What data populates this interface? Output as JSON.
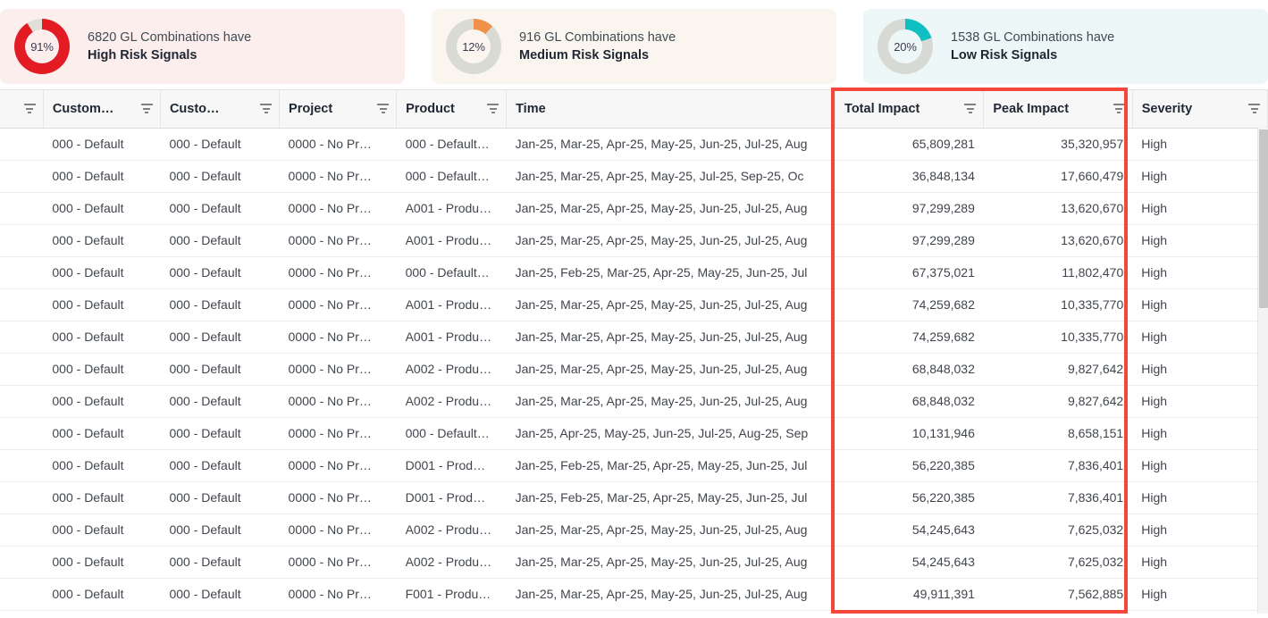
{
  "kpi_cards": [
    {
      "percent": "91%",
      "line1": "6820 GL Combinations have",
      "line2": "High Risk Signals",
      "accent": "#e31b23",
      "track": "#dfdfd6",
      "bg": "#fdeeee",
      "value": 91,
      "icon": "donut-chart-icon"
    },
    {
      "percent": "12%",
      "line1": "916 GL Combinations have",
      "line2": "Medium Risk Signals",
      "accent": "#f0914a",
      "track": "#d9dad2",
      "bg": "#faf6ef",
      "value": 12,
      "icon": "donut-chart-icon"
    },
    {
      "percent": "20%",
      "line1": "1538 GL Combinations have",
      "line2": "Low Risk Signals",
      "accent": "#0fbfc4",
      "track": "#d7dad4",
      "bg": "#eef7f8",
      "value": 20,
      "icon": "donut-chart-icon"
    }
  ],
  "table": {
    "columns": [
      {
        "key": "handle",
        "label": "",
        "filter": true,
        "align": "left"
      },
      {
        "key": "cust1",
        "label": "Custom…",
        "filter": true,
        "align": "left"
      },
      {
        "key": "cust2",
        "label": "Custo…",
        "filter": true,
        "align": "left"
      },
      {
        "key": "project",
        "label": "Project",
        "filter": true,
        "align": "left"
      },
      {
        "key": "product",
        "label": "Product",
        "filter": true,
        "align": "left"
      },
      {
        "key": "time",
        "label": "Time",
        "filter": false,
        "align": "left"
      },
      {
        "key": "total",
        "label": "Total Impact",
        "filter": true,
        "align": "right"
      },
      {
        "key": "peak",
        "label": "Peak Impact",
        "filter": true,
        "align": "right"
      },
      {
        "key": "severity",
        "label": "Severity",
        "filter": true,
        "align": "left"
      }
    ],
    "rows": [
      {
        "handle": "",
        "cust1": "000 - Default",
        "cust2": "000 - Default",
        "project": "0000 - No Pr…",
        "product": "000 - Default…",
        "time": "Jan-25, Mar-25, Apr-25, May-25, Jun-25, Jul-25, Aug",
        "total": "65,809,281",
        "peak": "35,320,957",
        "severity": "High"
      },
      {
        "handle": "",
        "cust1": "000 - Default",
        "cust2": "000 - Default",
        "project": "0000 - No Pr…",
        "product": "000 - Default…",
        "time": "Jan-25, Mar-25, Apr-25, May-25, Jul-25, Sep-25, Oc",
        "total": "36,848,134",
        "peak": "17,660,479",
        "severity": "High"
      },
      {
        "handle": "",
        "cust1": "000 - Default",
        "cust2": "000 - Default",
        "project": "0000 - No Pr…",
        "product": "A001 - Produ…",
        "time": "Jan-25, Mar-25, Apr-25, May-25, Jun-25, Jul-25, Aug",
        "total": "97,299,289",
        "peak": "13,620,670",
        "severity": "High"
      },
      {
        "handle": "",
        "cust1": "000 - Default",
        "cust2": "000 - Default",
        "project": "0000 - No Pr…",
        "product": "A001 - Produ…",
        "time": "Jan-25, Mar-25, Apr-25, May-25, Jun-25, Jul-25, Aug",
        "total": "97,299,289",
        "peak": "13,620,670",
        "severity": "High"
      },
      {
        "handle": "",
        "cust1": "000 - Default",
        "cust2": "000 - Default",
        "project": "0000 - No Pr…",
        "product": "000 - Default…",
        "time": "Jan-25, Feb-25, Mar-25, Apr-25, May-25, Jun-25, Jul",
        "total": "67,375,021",
        "peak": "11,802,470",
        "severity": "High"
      },
      {
        "handle": "",
        "cust1": "000 - Default",
        "cust2": "000 - Default",
        "project": "0000 - No Pr…",
        "product": "A001 - Produ…",
        "time": "Jan-25, Mar-25, Apr-25, May-25, Jun-25, Jul-25, Aug",
        "total": "74,259,682",
        "peak": "10,335,770",
        "severity": "High"
      },
      {
        "handle": "",
        "cust1": "000 - Default",
        "cust2": "000 - Default",
        "project": "0000 - No Pr…",
        "product": "A001 - Produ…",
        "time": "Jan-25, Mar-25, Apr-25, May-25, Jun-25, Jul-25, Aug",
        "total": "74,259,682",
        "peak": "10,335,770",
        "severity": "High"
      },
      {
        "handle": "",
        "cust1": "000 - Default",
        "cust2": "000 - Default",
        "project": "0000 - No Pr…",
        "product": "A002 - Produ…",
        "time": "Jan-25, Mar-25, Apr-25, May-25, Jun-25, Jul-25, Aug",
        "total": "68,848,032",
        "peak": "9,827,642",
        "severity": "High"
      },
      {
        "handle": "",
        "cust1": "000 - Default",
        "cust2": "000 - Default",
        "project": "0000 - No Pr…",
        "product": "A002 - Produ…",
        "time": "Jan-25, Mar-25, Apr-25, May-25, Jun-25, Jul-25, Aug",
        "total": "68,848,032",
        "peak": "9,827,642",
        "severity": "High"
      },
      {
        "handle": "",
        "cust1": "000 - Default",
        "cust2": "000 - Default",
        "project": "0000 - No Pr…",
        "product": "000 - Default…",
        "time": "Jan-25, Apr-25, May-25, Jun-25, Jul-25, Aug-25, Sep",
        "total": "10,131,946",
        "peak": "8,658,151",
        "severity": "High"
      },
      {
        "handle": "",
        "cust1": "000 - Default",
        "cust2": "000 - Default",
        "project": "0000 - No Pr…",
        "product": "D001 - Prod…",
        "time": "Jan-25, Feb-25, Mar-25, Apr-25, May-25, Jun-25, Jul",
        "total": "56,220,385",
        "peak": "7,836,401",
        "severity": "High"
      },
      {
        "handle": "",
        "cust1": "000 - Default",
        "cust2": "000 - Default",
        "project": "0000 - No Pr…",
        "product": "D001 - Prod…",
        "time": "Jan-25, Feb-25, Mar-25, Apr-25, May-25, Jun-25, Jul",
        "total": "56,220,385",
        "peak": "7,836,401",
        "severity": "High"
      },
      {
        "handle": "",
        "cust1": "000 - Default",
        "cust2": "000 - Default",
        "project": "0000 - No Pr…",
        "product": "A002 - Produ…",
        "time": "Jan-25, Mar-25, Apr-25, May-25, Jun-25, Jul-25, Aug",
        "total": "54,245,643",
        "peak": "7,625,032",
        "severity": "High"
      },
      {
        "handle": "",
        "cust1": "000 - Default",
        "cust2": "000 - Default",
        "project": "0000 - No Pr…",
        "product": "A002 - Produ…",
        "time": "Jan-25, Mar-25, Apr-25, May-25, Jun-25, Jul-25, Aug",
        "total": "54,245,643",
        "peak": "7,625,032",
        "severity": "High"
      },
      {
        "handle": "",
        "cust1": "000 - Default",
        "cust2": "000 - Default",
        "project": "0000 - No Pr…",
        "product": "F001 - Produ…",
        "time": "Jan-25, Mar-25, Apr-25, May-25, Jun-25, Jul-25, Aug",
        "total": "49,911,391",
        "peak": "7,562,885",
        "severity": "High"
      }
    ]
  },
  "annotation": {
    "type": "highlight-rectangle",
    "color": "#f5463c",
    "covers": [
      "Total Impact",
      "Peak Impact"
    ]
  },
  "severity_color": "#c0563a"
}
